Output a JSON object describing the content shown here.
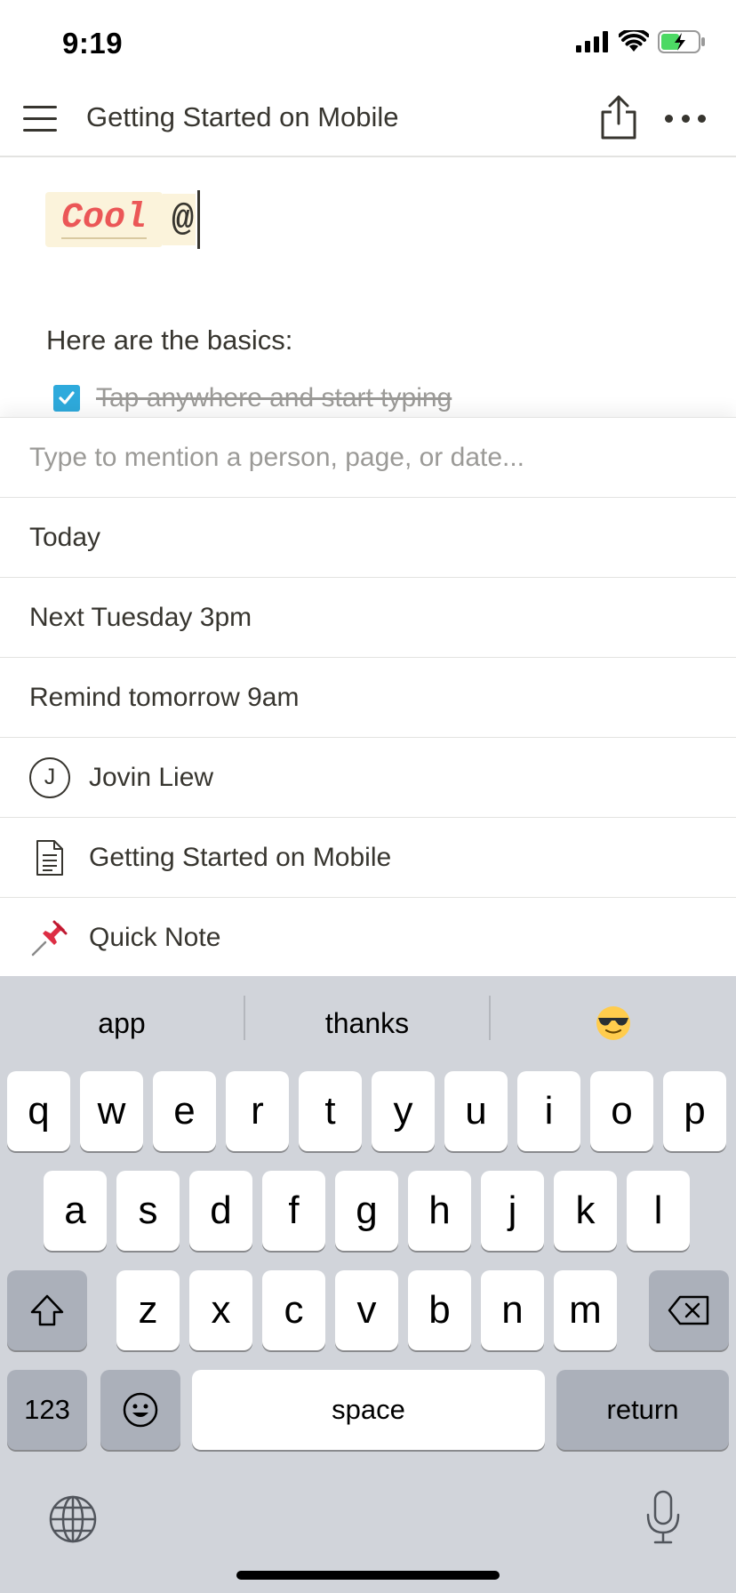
{
  "status_bar": {
    "time": "9:19",
    "icons": [
      "cellular-signal-icon",
      "wifi-icon",
      "battery-charging-icon"
    ],
    "battery_color": "#4cd964"
  },
  "nav": {
    "title": "Getting Started on Mobile",
    "icons": [
      "hamburger-menu-icon",
      "share-icon",
      "more-options-icon"
    ]
  },
  "document": {
    "code_text": "Cool",
    "mention_trigger": "@",
    "basics_text": "Here are the basics:",
    "todo": {
      "text": "Tap anywhere and start typing",
      "checked": true
    },
    "colors": {
      "code_background": "#fbf3db",
      "code_text": "#eb5757",
      "checkbox": "#2eaadc"
    }
  },
  "mention_menu": {
    "placeholder": "Type to mention a person, page, or date...",
    "items": [
      {
        "label": "Today",
        "icon": null
      },
      {
        "label": "Next Tuesday 3pm",
        "icon": null
      },
      {
        "label": "Remind tomorrow 9am",
        "icon": null
      },
      {
        "label": "Jovin Liew",
        "icon": "person-avatar-icon",
        "avatar_letter": "J"
      },
      {
        "label": "Getting Started on Mobile",
        "icon": "page-document-icon"
      },
      {
        "label": "Quick Note",
        "icon": "pushpin-icon"
      }
    ]
  },
  "keyboard": {
    "suggestions": [
      "app",
      "thanks",
      "😎"
    ],
    "row1": [
      "q",
      "w",
      "e",
      "r",
      "t",
      "y",
      "u",
      "i",
      "o",
      "p"
    ],
    "row2": [
      "a",
      "s",
      "d",
      "f",
      "g",
      "h",
      "j",
      "k",
      "l"
    ],
    "row3": [
      "z",
      "x",
      "c",
      "v",
      "b",
      "n",
      "m"
    ],
    "numbers_key": "123",
    "space_key": "space",
    "return_key": "return",
    "icons": [
      "shift-icon",
      "backspace-icon",
      "emoji-icon",
      "globe-icon",
      "microphone-icon"
    ]
  }
}
